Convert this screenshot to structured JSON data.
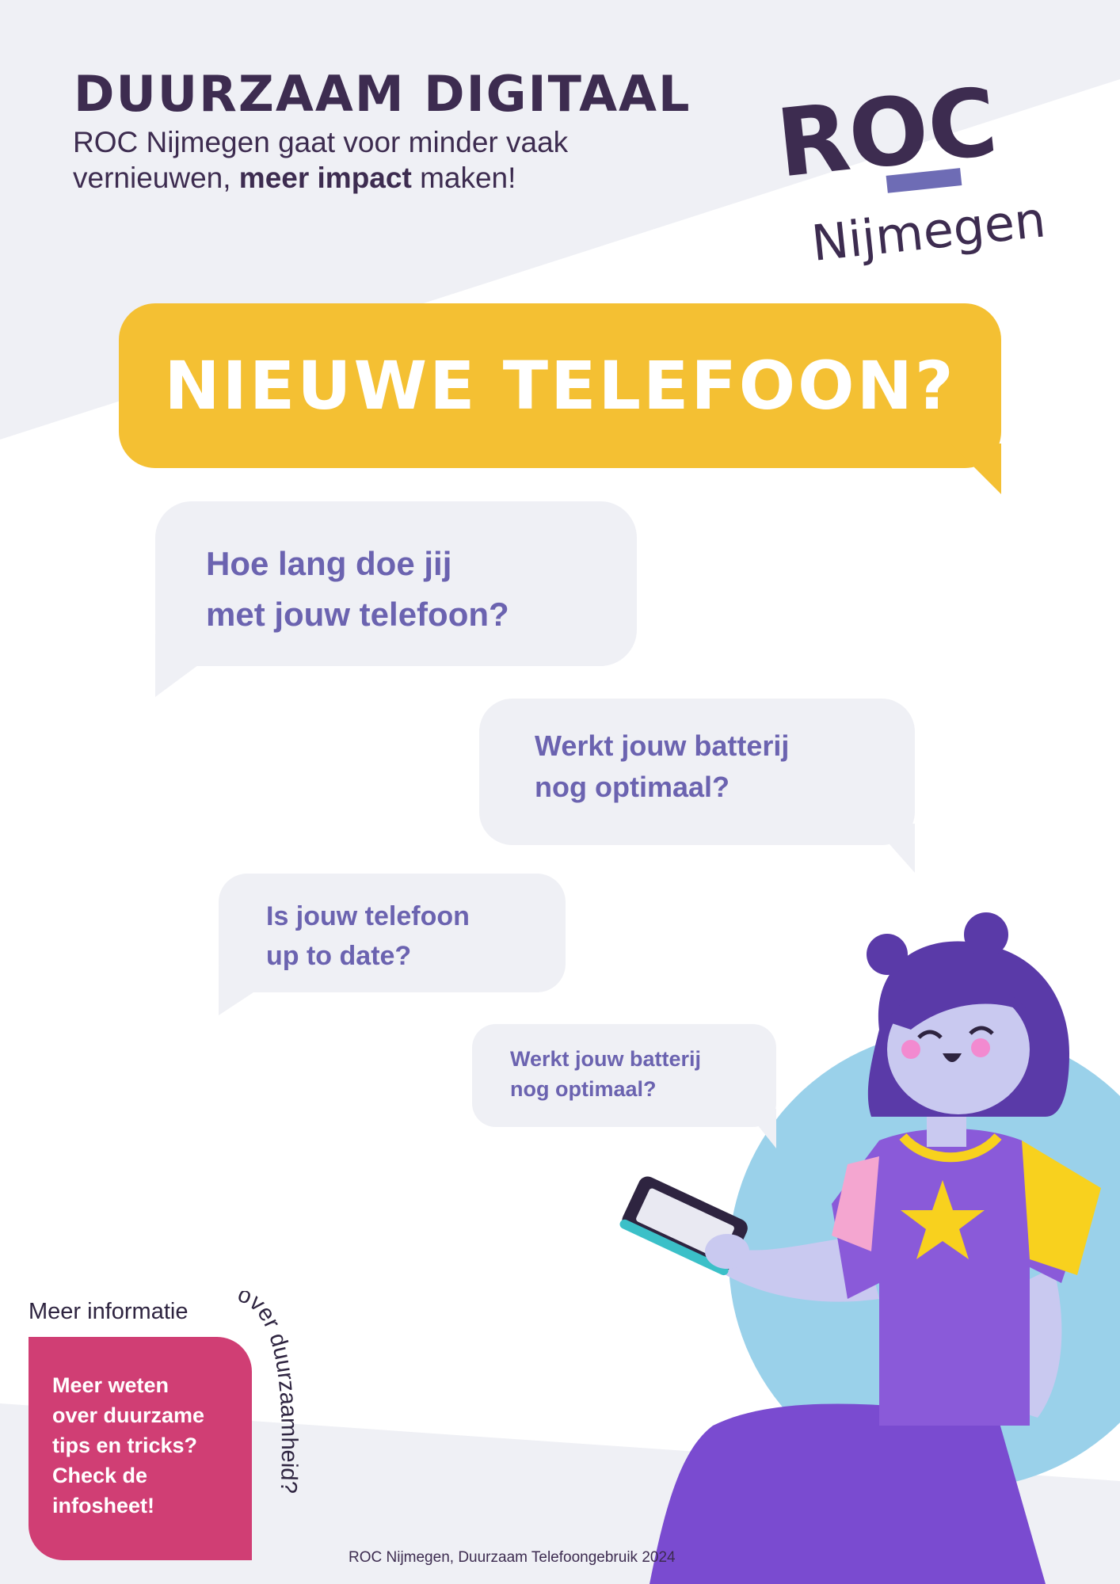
{
  "header": {
    "title": "DUURZAAM DIGITAAL",
    "subtitle_part1": "ROC Nijmegen gaat voor minder vaak vernieuwen, ",
    "subtitle_bold": "meer impact",
    "subtitle_part2": " maken!"
  },
  "logo": {
    "main": "ROC",
    "sub": "Nijmegen"
  },
  "headline": "NIEUWE TELEFOON?",
  "questions": [
    {
      "line1": "Hoe lang doe jij",
      "line2": "met jouw telefoon?"
    },
    {
      "line1": "Werkt jouw batterij",
      "line2": "nog optimaal?"
    },
    {
      "line1": "Is jouw telefoon",
      "line2": "up to date?"
    },
    {
      "line1": "Werkt jouw batterij",
      "line2": "nog optimaal?"
    }
  ],
  "info": {
    "lead": "Meer informatie",
    "curve": "over duurzaamheid?",
    "card_lines": [
      "Meer weten",
      "over duurzame",
      "tips en tricks?",
      "Check de",
      "infosheet!"
    ]
  },
  "footer": "ROC Nijmegen, Duurzaam Telefoongebruik 2024",
  "colors": {
    "navy": "#3d2c50",
    "yellow": "#f4c033",
    "lavender_text": "#6b63b0",
    "bubble_grey": "#eff0f5",
    "pink": "#d03e74",
    "sky": "#9ad1ea",
    "purple": "#8a5ad9"
  }
}
